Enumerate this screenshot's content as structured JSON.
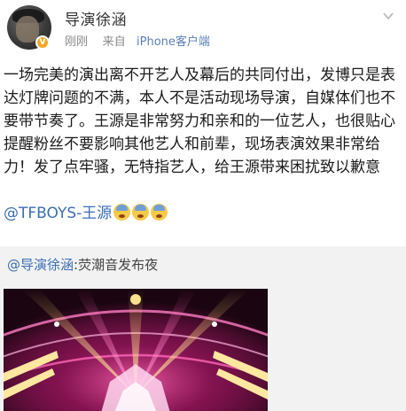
{
  "post": {
    "username": "导演徐涵",
    "time": "刚刚",
    "source_prefix": "来自",
    "source": "iPhone客户端",
    "body": "一场完美的演出离不开艺人及幕后的共同付出，发博只是表达灯牌问题的不满，本人不是活动现场导演，自媒体们也不要带节奏了。王源是非常努力和亲和的一位艺人，也很贴心提醒粉丝不要影响其他艺人和前辈，现场表演效果非常给力！发了点牢骚，无特指艺人，给王源带来困扰致以歉意",
    "mention": "@TFBOYS-王源",
    "emojis": [
      "scared-face-emoji",
      "scared-face-emoji",
      "scared-face-emoji"
    ]
  },
  "retweet": {
    "user": "@导演徐涵",
    "text": ":荧潮音发布夜"
  },
  "icons": {
    "menu": "chevron-down-icon",
    "badge": "vip-badge-icon"
  },
  "colors": {
    "link": "#3a6eb5",
    "meta": "#8a8a8a",
    "retweet_bg": "#f2f2f2",
    "badge": "#f5a623"
  }
}
